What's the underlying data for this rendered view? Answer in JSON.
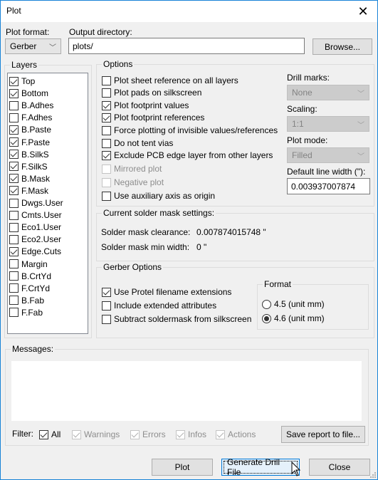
{
  "window": {
    "title": "Plot",
    "close_icon": "close-icon"
  },
  "top": {
    "plot_format_label": "Plot format:",
    "plot_format_value": "Gerber",
    "output_dir_label": "Output directory:",
    "output_dir_value": "plots/",
    "browse_label": "Browse..."
  },
  "layers": {
    "title": "Layers",
    "items": [
      {
        "label": "Top",
        "checked": true
      },
      {
        "label": "Bottom",
        "checked": true
      },
      {
        "label": "B.Adhes",
        "checked": false
      },
      {
        "label": "F.Adhes",
        "checked": false
      },
      {
        "label": "B.Paste",
        "checked": true
      },
      {
        "label": "F.Paste",
        "checked": true
      },
      {
        "label": "B.SilkS",
        "checked": true
      },
      {
        "label": "F.SilkS",
        "checked": true
      },
      {
        "label": "B.Mask",
        "checked": true
      },
      {
        "label": "F.Mask",
        "checked": true
      },
      {
        "label": "Dwgs.User",
        "checked": false
      },
      {
        "label": "Cmts.User",
        "checked": false
      },
      {
        "label": "Eco1.User",
        "checked": false
      },
      {
        "label": "Eco2.User",
        "checked": false
      },
      {
        "label": "Edge.Cuts",
        "checked": true
      },
      {
        "label": "Margin",
        "checked": false
      },
      {
        "label": "B.CrtYd",
        "checked": false
      },
      {
        "label": "F.CrtYd",
        "checked": false
      },
      {
        "label": "B.Fab",
        "checked": false
      },
      {
        "label": "F.Fab",
        "checked": false
      }
    ]
  },
  "options": {
    "title": "Options",
    "checkboxes": [
      {
        "label": "Plot sheet reference on all layers",
        "checked": false,
        "disabled": false
      },
      {
        "label": "Plot pads on silkscreen",
        "checked": false,
        "disabled": false
      },
      {
        "label": "Plot footprint values",
        "checked": true,
        "disabled": false
      },
      {
        "label": "Plot footprint references",
        "checked": true,
        "disabled": false
      },
      {
        "label": "Force plotting of invisible values/references",
        "checked": false,
        "disabled": false
      },
      {
        "label": "Do not tent vias",
        "checked": false,
        "disabled": false
      },
      {
        "label": "Exclude PCB edge layer from other layers",
        "checked": true,
        "disabled": false
      },
      {
        "label": "Mirrored plot",
        "checked": false,
        "disabled": true
      },
      {
        "label": "Negative plot",
        "checked": false,
        "disabled": true
      },
      {
        "label": "Use auxiliary axis as origin",
        "checked": false,
        "disabled": false
      }
    ],
    "drill_marks_label": "Drill marks:",
    "drill_marks_value": "None",
    "scaling_label": "Scaling:",
    "scaling_value": "1:1",
    "plot_mode_label": "Plot mode:",
    "plot_mode_value": "Filled",
    "line_width_label": "Default line width (\"):",
    "line_width_value": "0.003937007874"
  },
  "solder_mask": {
    "title": "Current solder mask settings:",
    "clearance_label": "Solder mask clearance:",
    "clearance_value": "0.007874015748 \"",
    "min_width_label": "Solder mask min width:",
    "min_width_value": "0 \""
  },
  "gerber": {
    "title": "Gerber Options",
    "checkboxes": [
      {
        "label": "Use Protel filename extensions",
        "checked": true
      },
      {
        "label": "Include extended attributes",
        "checked": false
      },
      {
        "label": "Subtract soldermask from silkscreen",
        "checked": false
      }
    ],
    "format_title": "Format",
    "formats": [
      {
        "label": "4.5 (unit mm)",
        "selected": false
      },
      {
        "label": "4.6 (unit mm)",
        "selected": true
      }
    ]
  },
  "messages": {
    "title": "Messages:",
    "filter_label": "Filter:",
    "filters": [
      {
        "label": "All",
        "checked": true,
        "disabled": false
      },
      {
        "label": "Warnings",
        "checked": true,
        "disabled": true
      },
      {
        "label": "Errors",
        "checked": true,
        "disabled": true
      },
      {
        "label": "Infos",
        "checked": true,
        "disabled": true
      },
      {
        "label": "Actions",
        "checked": true,
        "disabled": true
      }
    ],
    "save_report_label": "Save report to file..."
  },
  "buttons": {
    "plot": "Plot",
    "generate_drill": "Generate Drill File",
    "close": "Close"
  }
}
